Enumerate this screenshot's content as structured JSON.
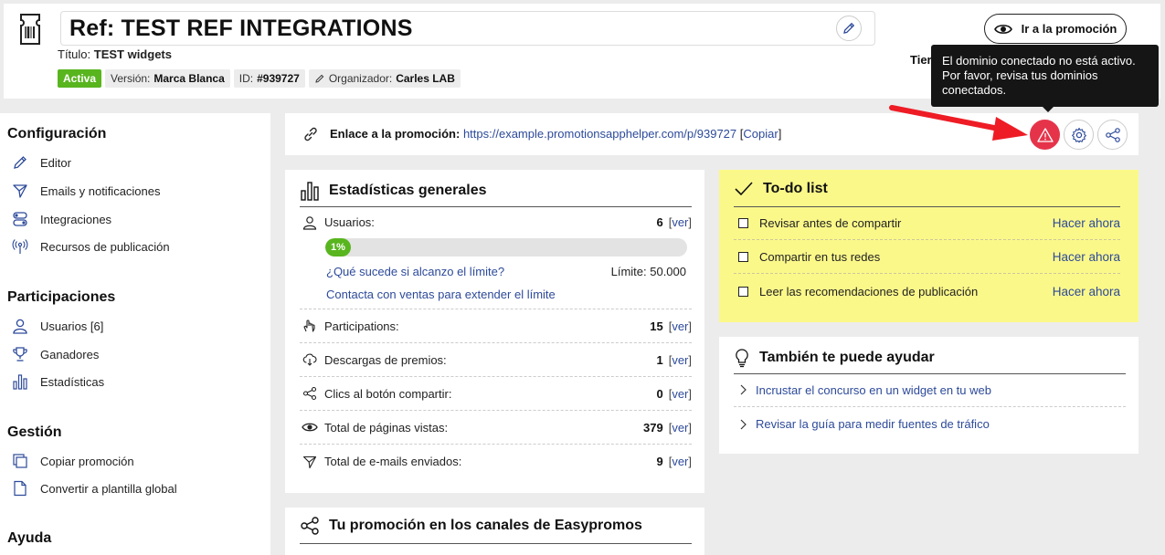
{
  "header": {
    "title": "Ref: TEST REF INTEGRATIONS",
    "subtitle_label": "Título:",
    "subtitle_value": "TEST widgets",
    "tags": {
      "status": "Activa",
      "version_label": "Versión:",
      "version_value": "Marca Blanca",
      "id_label": "ID:",
      "id_value": "#939727",
      "organizer_label": "Organizador:",
      "organizer_value": "Carles LAB"
    },
    "promo_button": "Ir a la promoción",
    "tier_partial": "Tier"
  },
  "tooltip": {
    "text": "El dominio conectado no está activo. Por favor, revisa tus dominios conectados."
  },
  "sidebar": {
    "sections": [
      {
        "title": "Configuración",
        "items": [
          {
            "label": "Editor",
            "icon": "pencil-icon"
          },
          {
            "label": "Emails y notificaciones",
            "icon": "send-icon"
          },
          {
            "label": "Integraciones",
            "icon": "toggles-icon"
          },
          {
            "label": "Recursos de publicación",
            "icon": "broadcast-icon"
          }
        ]
      },
      {
        "title": "Participaciones",
        "items": [
          {
            "label": "Usuarios [6]",
            "icon": "user-icon"
          },
          {
            "label": "Ganadores",
            "icon": "trophy-icon"
          },
          {
            "label": "Estadísticas",
            "icon": "bar-chart-icon"
          }
        ]
      },
      {
        "title": "Gestión",
        "items": [
          {
            "label": "Copiar promoción",
            "icon": "copy-icon"
          },
          {
            "label": "Convertir a plantilla global",
            "icon": "file-icon"
          }
        ]
      },
      {
        "title": "Ayuda",
        "items": []
      }
    ]
  },
  "linkbar": {
    "label": "Enlace a la promoción:",
    "url": "https://example.promotionsapphelper.com/p/939727",
    "copy_open": "[",
    "copy": "Copiar",
    "copy_close": "]"
  },
  "stats": {
    "title": "Estadísticas generales",
    "users_label": "Usuarios:",
    "users_value": "6",
    "progress_label": "1%",
    "progress_fraction": 0.01,
    "limit_question": "¿Qué sucede si alcanzo el límite?",
    "limit_text": "Límite: 50.000",
    "contact_sales": "Contacta con ventas para extender el límite",
    "ver": "ver",
    "rows": [
      {
        "label": "Participations:",
        "value": "15"
      },
      {
        "label": "Descargas de premios:",
        "value": "1"
      },
      {
        "label": "Clics al botón compartir:",
        "value": "0"
      },
      {
        "label": "Total de páginas vistas:",
        "value": "379"
      },
      {
        "label": "Total de e-mails enviados:",
        "value": "9"
      }
    ]
  },
  "channels": {
    "title": "Tu promoción en los canales de Easypromos"
  },
  "todo": {
    "title": "To-do list",
    "items": [
      {
        "label": "Revisar antes de compartir",
        "action": "Hacer ahora"
      },
      {
        "label": "Compartir en tus redes",
        "action": "Hacer ahora"
      },
      {
        "label": "Leer las recomendaciones de publicación",
        "action": "Hacer ahora"
      }
    ]
  },
  "help": {
    "title": "También te puede ayudar",
    "items": [
      "Incrustar el concurso en un widget en tu web",
      "Revisar la guía para medir fuentes de tráfico"
    ]
  },
  "colors": {
    "accent_link": "#2d4a9a",
    "active_green": "#58b51e",
    "alert_red": "#e5344a",
    "todo_yellow": "#fbf88a",
    "arrow_red": "#ee1c25"
  }
}
